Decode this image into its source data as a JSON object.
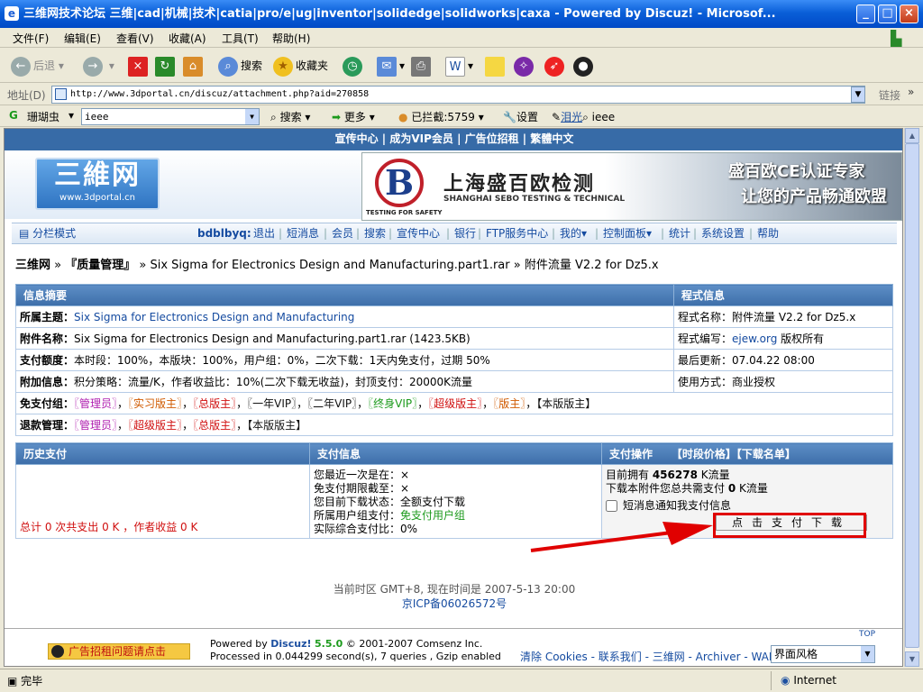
{
  "window": {
    "title": "三维网技术论坛 三维|cad|机械|技术|catia|pro/e|ug|inventor|solidedge|solidworks|caxa - Powered by Discuz! - Microsof..."
  },
  "menu": [
    "文件(F)",
    "编辑(E)",
    "查看(V)",
    "收藏(A)",
    "工具(T)",
    "帮助(H)"
  ],
  "toolbar": {
    "back": "后退",
    "search": "搜索",
    "favorites": "收藏夹"
  },
  "address": {
    "label": "地址(D)",
    "url": "http://www.3dportal.cn/discuz/attachment.php?aid=270858",
    "go": "链接",
    "more": "»"
  },
  "searchbar": {
    "brand": "珊瑚虫",
    "query": "ieee",
    "search": "搜索",
    "more": "更多",
    "blocked": "已拦截:5759",
    "settings": "设置",
    "highlight": "泪光",
    "query2": "ieee"
  },
  "site": {
    "topnav": "宣传中心 | 成为VIP会员 | 广告位招租 | 繁體中文",
    "logo_main": "三維网",
    "logo_sub": "www.3dportal.cn",
    "banner": {
      "cn": "上海盛百欧检测",
      "en": "SHANGHAI SEBO TESTING & TECHNICAL",
      "tag": "TESTING FOR SAFETY",
      "slogan1": "盛百欧CE认证专家",
      "slogan2": "让您的产品畅通欧盟",
      "letter": "B"
    },
    "nav": {
      "mode": "分栏模式",
      "user": "bdblbyq:",
      "items": [
        "退出",
        "短消息",
        "会员",
        "搜索",
        "宣传中心",
        "银行",
        "FTP服务中心",
        "我的▾",
        "控制面板▾",
        "统计",
        "系统设置",
        "帮助"
      ]
    },
    "breadcrumb": {
      "home": "三维网",
      "forum": "『质量管理』",
      "thread": "Six Sigma for Electronics Design and Manufacturing.part1.rar",
      "page": "附件流量 V2.2 for Dz5.x"
    },
    "info": {
      "header_left": "信息摘要",
      "header_right": "程式信息",
      "rows": [
        {
          "label": "所属主题：",
          "value": "Six Sigma for Electronics Design and Manufacturing",
          "right": "程式名称：附件流量 V2.2 for Dz5.x"
        },
        {
          "label": "附件名称：",
          "value": "Six Sigma for Electronics Design and Manufacturing.part1.rar (1423.5KB)",
          "right_prefix": "程式编写：",
          "right_link": "ejew.org",
          "right_suffix": " 版权所有"
        },
        {
          "label": "支付额度：",
          "value": "本时段：100%，本版块：100%，用户组：0%，二次下载：1天内免支付，过期 50%",
          "right": "最后更新：07.04.22 08:00"
        },
        {
          "label": "附加信息：",
          "value": "积分策略：流量/K，作者收益比：10%(二次下载无收益)，封顶支付：20000K流量",
          "right": "使用方式：商业授权"
        }
      ],
      "free_label": "免支付组：",
      "free_groups": [
        "〖管理员〗",
        "〖实习版主〗",
        "〖总版主〗",
        "〖一年VIP〗",
        "〖二年VIP〗",
        "〖终身VIP〗",
        "〖超级版主〗",
        "〖版主〗",
        "【本版版主】"
      ],
      "refund_label": "退款管理：",
      "refund_groups": [
        "〖管理员〗",
        "〖超级版主〗",
        "〖总版主〗",
        "【本版版主】"
      ]
    },
    "pay": {
      "h1": "历史支付",
      "h2": "支付信息",
      "h3": "支付操作",
      "h3_links": "【时段价格】【下载名单】",
      "history": "总计 0 次共支出 0 K ，作者收益 0 K",
      "info_lines": [
        "您最近一次是在：×",
        "免支付期限截至：×",
        "您目前下载状态：全额支付下载"
      ],
      "group_label": "所属用户组支付：",
      "group_value": "免支付用户组",
      "actual": "实际综合支付比：0%",
      "own_prefix": "目前拥有 ",
      "own_value": "456278",
      "own_suffix": " K流量",
      "need_prefix": "下载本附件您总共需支付 ",
      "need_value": "0",
      "need_suffix": " K流量",
      "notify": "短消息通知我支付信息",
      "button": "点击支付下载"
    },
    "footer": {
      "time": "当前时区 GMT+8, 现在时间是 2007-5-13 20:00",
      "icp": "京ICP备06026572号",
      "ad": "广告招租问题请点击",
      "powered_prefix": "Powered by ",
      "powered_name": "Discuz!",
      "powered_ver": "5.5.0",
      "powered_copy": " © 2001-2007 Comsenz Inc.",
      "processed": "Processed in 0.044299 second(s), 7 queries , Gzip enabled",
      "links": "清除 Cookies - 联系我们 - 三维网 - Archiver - WAP",
      "style": "界面风格",
      "top": "TOP"
    }
  },
  "status": {
    "left": "完毕",
    "zone": "Internet"
  }
}
